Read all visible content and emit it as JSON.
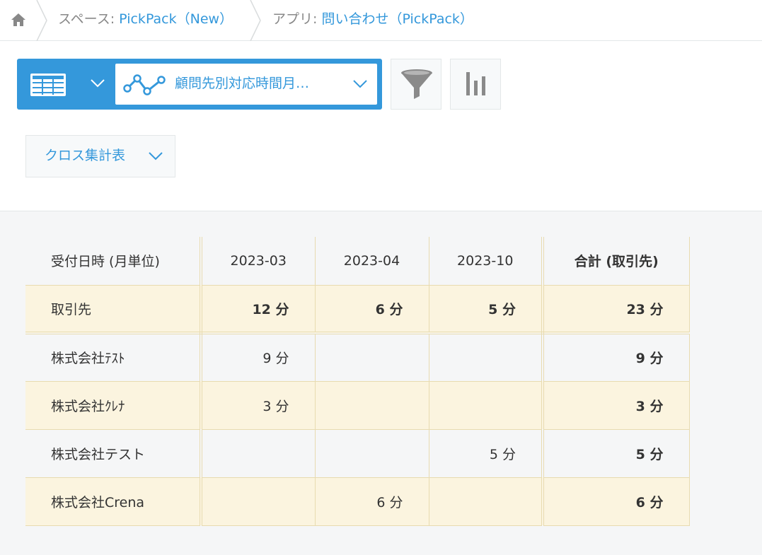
{
  "breadcrumb": {
    "space_prefix": "スペース: ",
    "space_name": "PickPack（New）",
    "app_prefix": "アプリ: ",
    "app_name": "問い合わせ（PickPack）"
  },
  "toolbar": {
    "view_name": "顧問先別対応時間月…",
    "chart_type": "クロス集計表"
  },
  "colors": {
    "accent": "#3498db",
    "row_highlight": "#fbf4df",
    "border": "#e8dbb0",
    "area_bg": "#f5f6f7"
  },
  "table": {
    "headers": [
      "受付日時 (月単位)",
      "2023-03",
      "2023-04",
      "2023-10",
      "合計 (取引先)"
    ],
    "summary": {
      "label": "取引先",
      "values": [
        "12 分",
        "6 分",
        "5 分",
        "23 分"
      ]
    },
    "rows": [
      {
        "label": "株式会社ﾃｽﾄ",
        "values": [
          "9 分",
          "",
          "",
          "9 分"
        ]
      },
      {
        "label": "株式会社ｸﾚﾅ",
        "values": [
          "3 分",
          "",
          "",
          "3 分"
        ]
      },
      {
        "label": "株式会社テスト",
        "values": [
          "",
          "",
          "5 分",
          "5 分"
        ]
      },
      {
        "label": "株式会社Crena",
        "values": [
          "",
          "6 分",
          "",
          "6 分"
        ]
      }
    ]
  }
}
